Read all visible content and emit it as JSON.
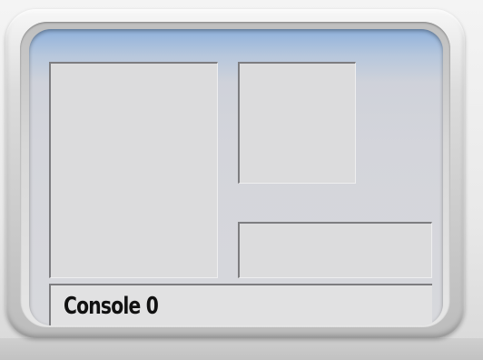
{
  "console": {
    "label": "Console 0"
  },
  "colors": {
    "screen_top": "#8fb1dc",
    "panel_fill": "#dcdcdd",
    "panel_border": "#7d7d80",
    "console_text": "#111111"
  }
}
